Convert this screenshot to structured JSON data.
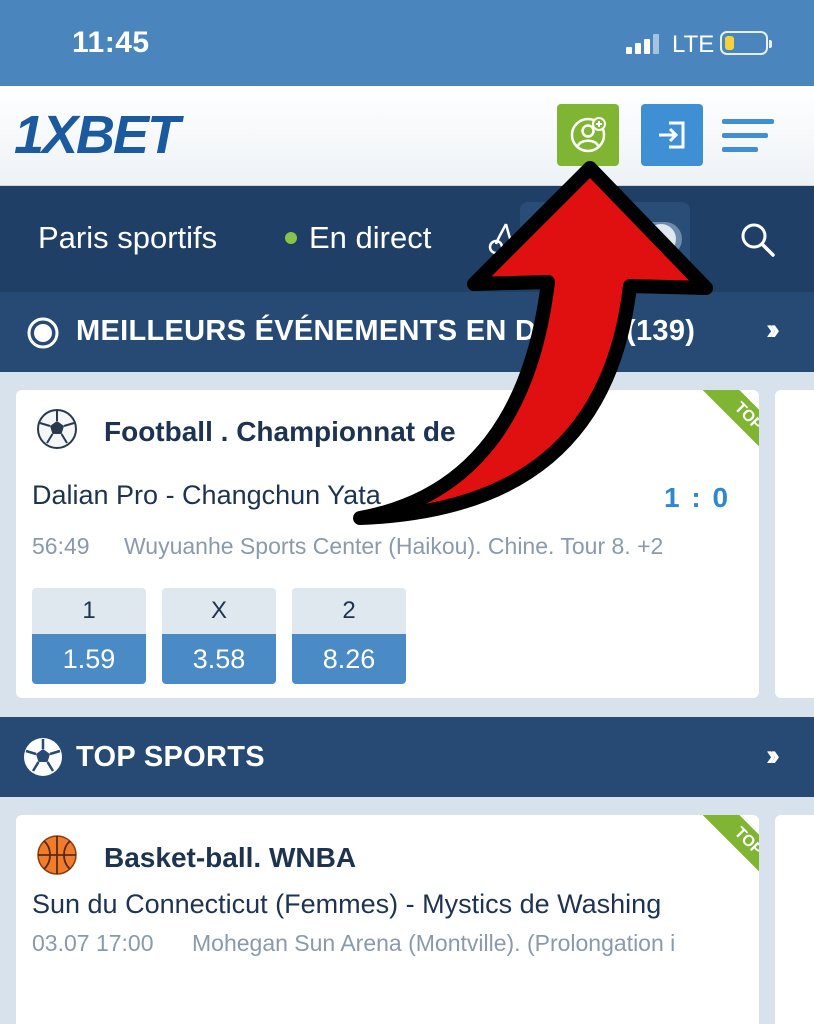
{
  "status_bar": {
    "time": "11:45",
    "network": "LTE"
  },
  "header": {
    "logo": "1XBET",
    "register_icon": "user-plus-icon",
    "login_icon": "sign-in-icon",
    "menu_icon": "hamburger-menu-icon"
  },
  "nav": {
    "sports_label": "Paris sportifs",
    "live_label": "En direct",
    "search_icon": "search-icon"
  },
  "live_section": {
    "title": "MEILLEURS ÉVÉNEMENTS EN DI",
    "count": "(139)",
    "more": "››"
  },
  "live_card": {
    "sport": "Football . Championnat de",
    "badge": "TOP",
    "teams": "Dalian Pro - Changchun Yata",
    "score": "1 : 0",
    "time": "56:49",
    "venue": "Wuyuanhe Sports Center (Haikou). Chine. Tour 8. +2",
    "odds": [
      {
        "label": "1",
        "value": "1.59"
      },
      {
        "label": "X",
        "value": "3.58"
      },
      {
        "label": "2",
        "value": "8.26"
      }
    ]
  },
  "top_section": {
    "title": "TOP SPORTS",
    "more": "››"
  },
  "top_card": {
    "sport": "Basket-ball. WNBA",
    "badge": "TOP",
    "teams": "Sun du Connecticut (Femmes) - Mystics de Washing",
    "datetime": "03.07 17:00",
    "venue": "Mohegan Sun Arena (Montville). (Prolongation i"
  },
  "colors": {
    "status_blue": "#4a86bd",
    "nav_navy": "#1f3f66",
    "brand_blue": "#1b5a9e",
    "register_green": "#7fb532",
    "login_blue": "#3e8fd3",
    "arrow_red": "#e01010"
  }
}
